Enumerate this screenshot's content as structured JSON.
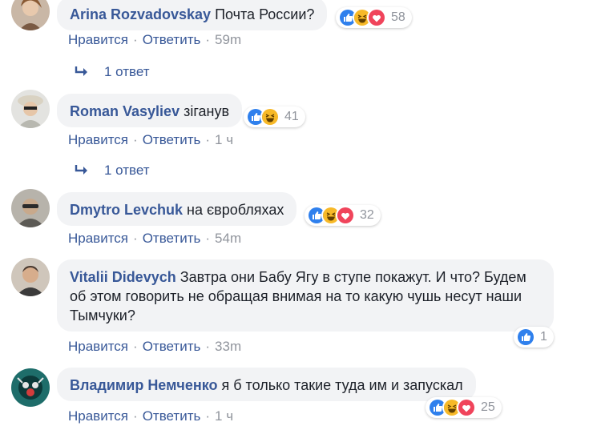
{
  "colors": {
    "link": "#385898",
    "meta": "#90949c",
    "bubble": "#f2f3f5",
    "like": "#2f80ed",
    "haha": "#f7b928",
    "love": "#f0445b"
  },
  "comments": [
    {
      "author": "Arina Rozvadovskay",
      "text": "Почта России?",
      "reactions": [
        "like-icon",
        "haha-icon",
        "love-icon"
      ],
      "reaction_count": "58",
      "like_label": "Нравится",
      "reply_label": "Ответить",
      "time": "59m",
      "replies_label": "1 ответ"
    },
    {
      "author": "Roman Vasyliev",
      "text": "зіганув",
      "reactions": [
        "like-icon",
        "haha-icon"
      ],
      "reaction_count": "41",
      "like_label": "Нравится",
      "reply_label": "Ответить",
      "time": "1 ч",
      "replies_label": "1 ответ"
    },
    {
      "author": "Dmytro Levchuk",
      "text": "на євробляхах",
      "reactions": [
        "like-icon",
        "haha-icon",
        "love-icon"
      ],
      "reaction_count": "32",
      "like_label": "Нравится",
      "reply_label": "Ответить",
      "time": "54m"
    },
    {
      "author": "Vitalii Didevych",
      "text": "Завтра они Бабу Ягу в ступе покажут. И что? Будем об этом говорить не обращая внимая на то какую чушь несут наши Тымчуки?",
      "reactions": [
        "like-icon"
      ],
      "reaction_count": "1",
      "like_label": "Нравится",
      "reply_label": "Ответить",
      "time": "33m"
    },
    {
      "author": "Владимир Немченко",
      "text": "я б только такие туда им и запускал",
      "reactions": [
        "like-icon",
        "haha-icon",
        "love-icon"
      ],
      "reaction_count": "25",
      "like_label": "Нравится",
      "reply_label": "Ответить",
      "time": "1 ч"
    }
  ]
}
